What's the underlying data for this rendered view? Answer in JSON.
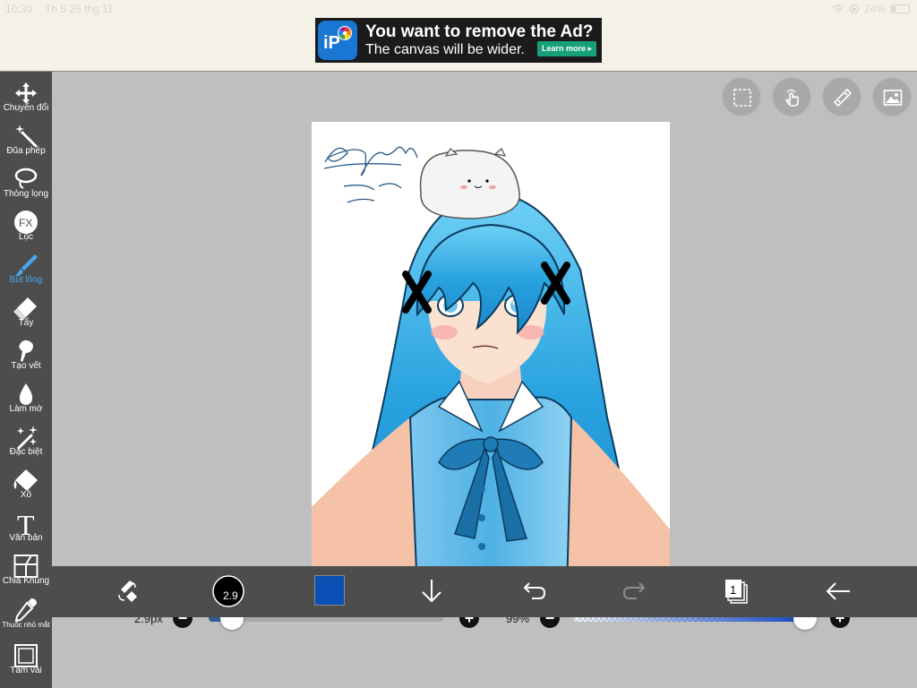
{
  "status": {
    "time": "10:30",
    "date": "Th 5 25 thg 11",
    "battery": "24%",
    "battery_level": 0.24
  },
  "ad": {
    "title": "You want to remove the Ad?",
    "subtitle": "The canvas will be wider.",
    "button": "Learn more ▸"
  },
  "tools": [
    {
      "label": "Chuyển đổi",
      "icon": "move-icon"
    },
    {
      "label": "Đũa phép",
      "icon": "magic-wand-icon"
    },
    {
      "label": "Thòng lọng",
      "icon": "lasso-icon"
    },
    {
      "label": "Lọc",
      "icon": "filter-fx-icon"
    },
    {
      "label": "Bút lông",
      "icon": "brush-icon",
      "active": true
    },
    {
      "label": "Tẩy",
      "icon": "eraser-icon"
    },
    {
      "label": "Tạo vết",
      "icon": "smudge-icon"
    },
    {
      "label": "Làm mờ",
      "icon": "blur-drop-icon"
    },
    {
      "label": "Đặc biệt",
      "icon": "special-sparkle-icon"
    },
    {
      "label": "Xô",
      "icon": "bucket-icon"
    },
    {
      "label": "Văn bản",
      "icon": "text-icon"
    },
    {
      "label": "Chia Khung",
      "icon": "frame-divider-icon"
    },
    {
      "label": "Thuốc nhỏ mắt",
      "icon": "eyedropper-icon"
    },
    {
      "label": "Tấm vải",
      "icon": "canvas-icon"
    }
  ],
  "top_right_buttons": [
    "selection-icon",
    "touch-gesture-icon",
    "ruler-icon",
    "image-icon"
  ],
  "brush_size": {
    "label": "2.9px",
    "value": 2.9,
    "fraction": 0.1
  },
  "opacity": {
    "label": "99%",
    "value": 99
  },
  "bottom": {
    "brush_size_badge": "2.9",
    "layer_count": "1",
    "color": "#0a4fb3"
  }
}
